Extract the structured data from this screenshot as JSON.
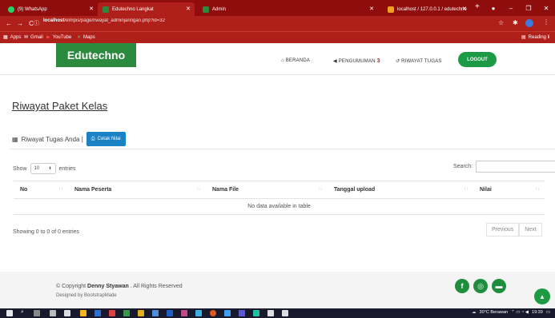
{
  "browser": {
    "tabs": [
      {
        "label": "(9) WhatsApp",
        "icon": "whatsapp-icon",
        "active": false
      },
      {
        "label": "Edutechno Langkat",
        "icon": "edutechno-icon",
        "active": true
      },
      {
        "label": "Admin",
        "icon": "admin-icon",
        "active": false
      },
      {
        "label": "localhost / 127.0.0.1 / edutechno",
        "icon": "phpmyadmin-icon",
        "active": false
      }
    ],
    "url_host": "localhost",
    "url_path": "/elmpis/page/riwayat_adminjaringan.php?id=32",
    "bookmarks": [
      "Apps",
      "Gmail",
      "YouTube",
      "Maps"
    ],
    "reading_list": "Reading li"
  },
  "site": {
    "brand": "Edutechno",
    "nav": {
      "beranda": "BERANDA",
      "pengumuman": "PENGUMUMAN",
      "pengumuman_count": "3",
      "riwayat": "RIWAYAT TUGAS",
      "logout": "LOGOUT"
    },
    "page_title": "Riwayat Paket Kelas",
    "subtitle": "Riwayat Tugas Anda |",
    "cetak_label": "Cetak Nilai",
    "table": {
      "show_label": "Show",
      "entries_value": "10",
      "entries_label": "entries",
      "search_label": "Search:",
      "columns": [
        "No",
        "Nama Peserta",
        "Nama File",
        "Tanggal upload",
        "Nilai"
      ],
      "empty_text": "No data available in table",
      "info": "Showing 0 to 0 of 0 entries",
      "prev": "Previous",
      "next": "Next"
    },
    "footer": {
      "copyright_prefix": "© Copyright",
      "copyright_name": "Denny Styawan",
      "copyright_suffix": ". All Rights Reserved",
      "designed_by": "Designed by BootstrapMade",
      "social": [
        "facebook-icon",
        "instagram-icon",
        "chat-icon"
      ]
    }
  },
  "taskbar": {
    "weather": "30°C Berawan",
    "time": "19:39"
  },
  "colors": {
    "chrome_dark": "#8f0d0d",
    "chrome": "#b0201a",
    "brand_green": "#2b8a3e",
    "button_blue": "#1a82c5"
  }
}
